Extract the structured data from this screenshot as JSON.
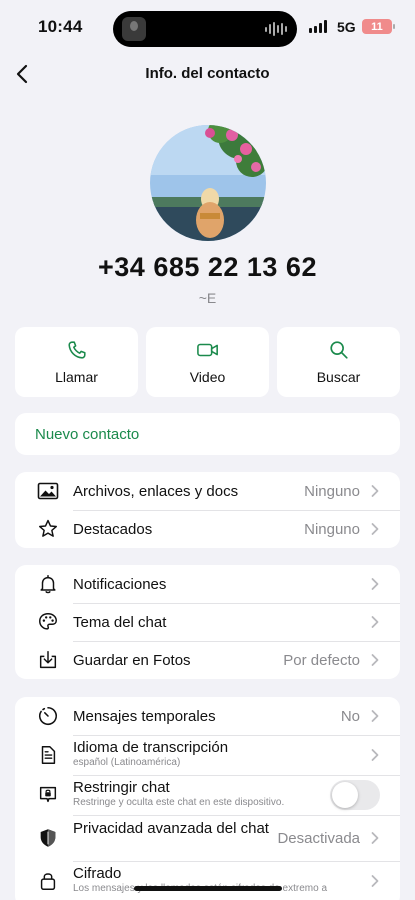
{
  "status_bar": {
    "time": "10:44",
    "network": "5G",
    "battery": "11"
  },
  "nav": {
    "title": "Info. del contacto"
  },
  "contact": {
    "phone": "+34 685 22 13 62",
    "nickname": "~E"
  },
  "actions": [
    {
      "label": "Llamar",
      "icon": "phone-icon"
    },
    {
      "label": "Video",
      "icon": "video-camera-icon"
    },
    {
      "label": "Buscar",
      "icon": "search-icon"
    }
  ],
  "new_contact": {
    "label": "Nuevo contacto"
  },
  "media_section": [
    {
      "label": "Archivos, enlaces y docs",
      "value": "Ninguno",
      "icon": "photo-icon"
    },
    {
      "label": "Destacados",
      "value": "Ninguno",
      "icon": "star-icon"
    }
  ],
  "settings_section": [
    {
      "label": "Notificaciones",
      "value": "",
      "icon": "bell-icon"
    },
    {
      "label": "Tema del chat",
      "value": "",
      "icon": "palette-icon"
    },
    {
      "label": "Guardar en Fotos",
      "value": "Por defecto",
      "icon": "download-icon"
    }
  ],
  "privacy_section": {
    "temporal": {
      "label": "Mensajes temporales",
      "value": "No",
      "icon": "timer-icon"
    },
    "transcription": {
      "label": "Idioma de transcripción",
      "sub": "español (Latinoamérica)",
      "icon": "document-icon"
    },
    "restrict": {
      "label": "Restringir chat",
      "sub": "Restringe y oculta este chat en este dispositivo.",
      "icon": "chat-lock-icon",
      "enabled": false
    },
    "advanced": {
      "label": "Privacidad avanzada del chat",
      "value": "Desactivada",
      "icon": "shield-icon"
    },
    "encryption": {
      "label": "Cifrado",
      "sub": "Los mensajes y las llamadas están cifrados de extremo a",
      "icon": "lock-icon"
    }
  },
  "colors": {
    "accent": "#1b8a4c",
    "background": "#f2f2f7",
    "card": "#ffffff",
    "secondary_text": "#8a8a8e"
  }
}
